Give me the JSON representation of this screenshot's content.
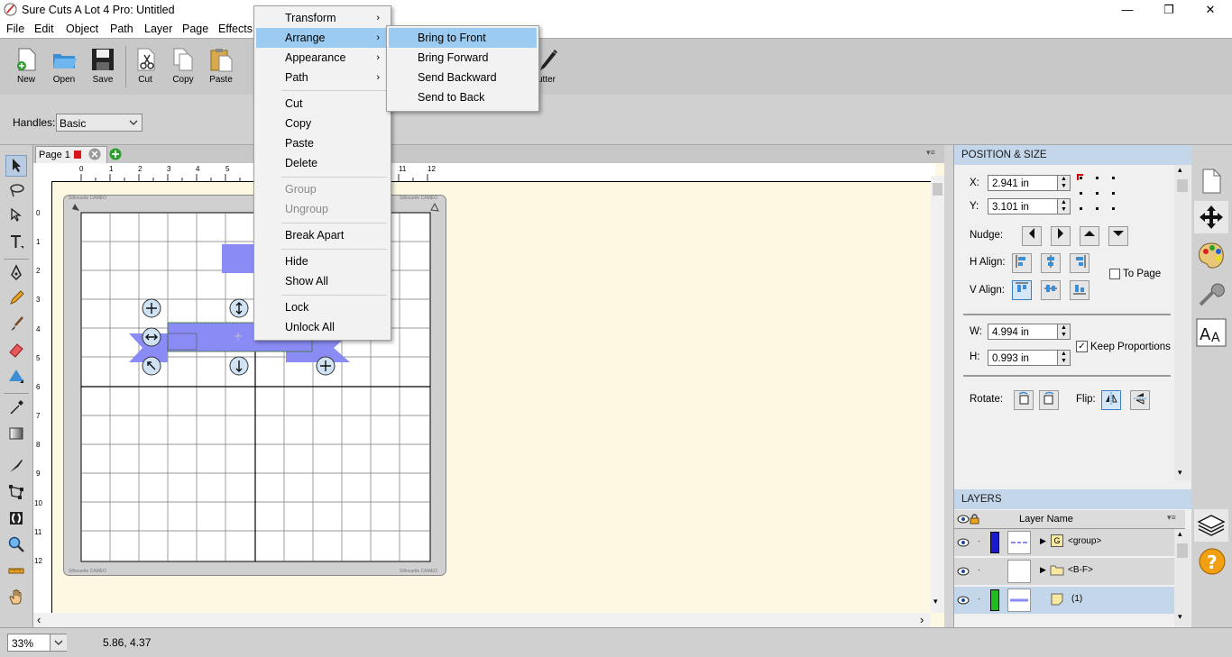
{
  "window": {
    "title": "Sure Cuts A Lot 4 Pro: Untitled",
    "minimize": "—",
    "maximize": "❐",
    "close": "✕"
  },
  "menubar": [
    "File",
    "Edit",
    "Object",
    "Path",
    "Layer",
    "Page",
    "Effects"
  ],
  "toolbar": {
    "left": [
      {
        "label": "New",
        "icon": "new-document-icon"
      },
      {
        "label": "Open",
        "icon": "open-folder-icon"
      },
      {
        "label": "Save",
        "icon": "floppy-disk-icon"
      },
      {
        "label": "Cut",
        "icon": "scissors-icon"
      },
      {
        "label": "Copy",
        "icon": "copy-icon"
      },
      {
        "label": "Paste",
        "icon": "paste-icon"
      }
    ],
    "cutter_label": "utter"
  },
  "handles": {
    "label": "Handles:",
    "value": "Basic"
  },
  "page_tab": {
    "label": "Page 1"
  },
  "ruler": {
    "top": [
      "0",
      "1",
      "2",
      "3",
      "4",
      "5",
      "11",
      "12"
    ],
    "left": [
      "0",
      "1",
      "2",
      "3",
      "4",
      "5",
      "6",
      "7",
      "8",
      "9",
      "10",
      "11",
      "12"
    ]
  },
  "mat": {
    "brand_tl": "Silhouette CAMEO",
    "brand_tr": "Silhouette CAMEO",
    "brand_bl": "Silhouette CAMEO",
    "brand_br": "Silhouette CAMEO"
  },
  "context_menu": {
    "items": [
      {
        "label": "Transform",
        "submenu": true
      },
      {
        "label": "Arrange",
        "submenu": true,
        "highlighted": true
      },
      {
        "label": "Appearance",
        "submenu": true
      },
      {
        "label": "Path",
        "submenu": true
      },
      {
        "label": "Cut"
      },
      {
        "label": "Copy"
      },
      {
        "label": "Paste"
      },
      {
        "label": "Delete"
      },
      {
        "label": "Group",
        "disabled": true
      },
      {
        "label": "Ungroup",
        "disabled": true
      },
      {
        "label": "Break Apart"
      },
      {
        "label": "Hide"
      },
      {
        "label": "Show All"
      },
      {
        "label": "Lock"
      },
      {
        "label": "Unlock All"
      }
    ],
    "arrow": "›"
  },
  "arrange_submenu": {
    "items": [
      {
        "label": "Bring to Front",
        "highlighted": true
      },
      {
        "label": "Bring Forward"
      },
      {
        "label": "Send Backward"
      },
      {
        "label": "Send to Back"
      }
    ]
  },
  "position_size": {
    "header": "POSITION & SIZE",
    "x_label": "X:",
    "x_value": "2.941 in",
    "y_label": "Y:",
    "y_value": "3.101 in",
    "nudge_label": "Nudge:",
    "halign_label": "H Align:",
    "valign_label": "V Align:",
    "to_page_label": "To Page",
    "to_page_checked": false,
    "w_label": "W:",
    "w_value": "4.994 in",
    "h_label": "H:",
    "h_value": "0.993 in",
    "keep_proportions_label": "Keep Proportions",
    "keep_proportions_checked": true,
    "rotate_label": "Rotate:",
    "flip_label": "Flip:"
  },
  "layers": {
    "header": "LAYERS",
    "column_label": "Layer Name",
    "rows": [
      {
        "name": "<group>",
        "badge": "G",
        "color": "#1a1acc",
        "expander": "▶"
      },
      {
        "name": "<B-F>",
        "badge": "",
        "color": "",
        "expander": "▶"
      },
      {
        "name": "(1)",
        "badge": "",
        "color": "#22bb22",
        "expander": ""
      }
    ]
  },
  "status": {
    "zoom": "33%",
    "coords": "5.86, 4.37"
  },
  "colors": {
    "accent": "#9ccbf1",
    "shape": "#8b8bf5",
    "panel_header": "#c4d7ea"
  }
}
